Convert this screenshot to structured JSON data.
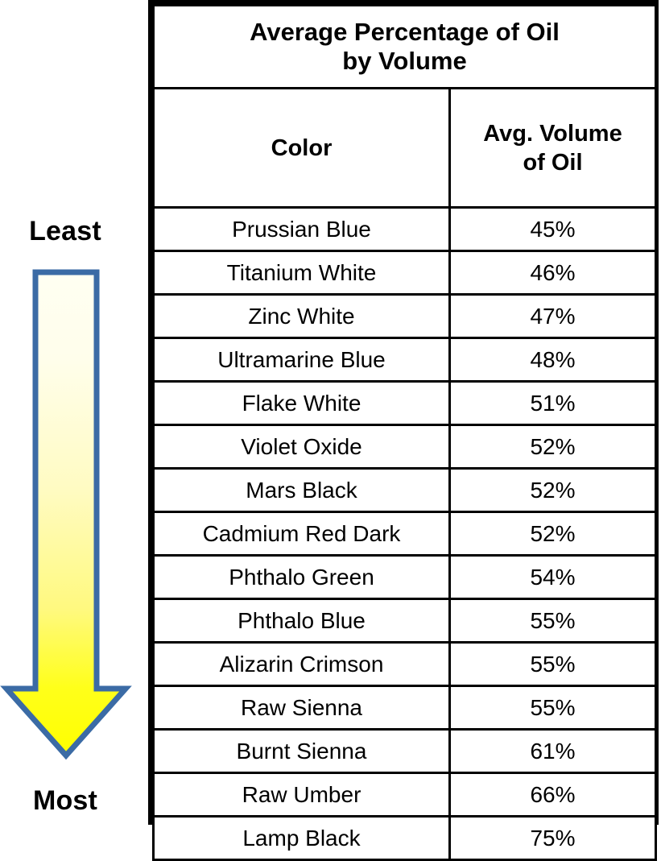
{
  "gauge": {
    "top_label": "Least",
    "bottom_label": "Most",
    "arrow_direction": "down",
    "arrow_fill_top_color": "#FFFFF2",
    "arrow_fill_bottom_color": "#FFFF00",
    "arrow_border_color": "#3B6BA5"
  },
  "table": {
    "title": "Average Percentage of Oil",
    "title_line2": "by Volume",
    "title_bg_color": "#FFC000",
    "headers": {
      "color": "Color",
      "volume_line1": "Avg. Volume",
      "volume_line2": "of Oil"
    }
  },
  "chart_data": {
    "type": "table",
    "title": "Average Percentage of Oil by Volume",
    "columns": [
      "Color",
      "Avg. Volume of Oil"
    ],
    "categories": [
      "Prussian Blue",
      "Titanium White",
      "Zinc White",
      "Ultramarine Blue",
      "Flake White",
      "Violet Oxide",
      "Mars Black",
      "Cadmium Red Dark",
      "Phthalo Green",
      "Phthalo Blue",
      "Alizarin Crimson",
      "Raw Sienna",
      "Burnt Sienna",
      "Raw Umber",
      "Lamp Black"
    ],
    "values": [
      45,
      46,
      47,
      48,
      51,
      52,
      52,
      52,
      54,
      55,
      55,
      55,
      61,
      66,
      75
    ],
    "value_labels": [
      "45%",
      "46%",
      "47%",
      "48%",
      "51%",
      "52%",
      "52%",
      "52%",
      "54%",
      "55%",
      "55%",
      "55%",
      "61%",
      "66%",
      "75%"
    ],
    "ylabel": "Avg. Volume of Oil",
    "xlabel": "Color",
    "unit": "%",
    "sort_order": "ascending",
    "annotations": [
      "Least",
      "Most"
    ],
    "rows": [
      {
        "color": "Prussian Blue",
        "volume": "45%"
      },
      {
        "color": "Titanium White",
        "volume": "46%"
      },
      {
        "color": "Zinc White",
        "volume": "47%"
      },
      {
        "color": "Ultramarine Blue",
        "volume": "48%"
      },
      {
        "color": "Flake White",
        "volume": "51%"
      },
      {
        "color": "Violet Oxide",
        "volume": "52%"
      },
      {
        "color": "Mars Black",
        "volume": "52%"
      },
      {
        "color": "Cadmium Red Dark",
        "volume": "52%"
      },
      {
        "color": "Phthalo Green",
        "volume": "54%"
      },
      {
        "color": "Phthalo Blue",
        "volume": "55%"
      },
      {
        "color": "Alizarin Crimson",
        "volume": "55%"
      },
      {
        "color": "Raw Sienna",
        "volume": "55%"
      },
      {
        "color": "Burnt Sienna",
        "volume": "61%"
      },
      {
        "color": "Raw Umber",
        "volume": "66%"
      },
      {
        "color": "Lamp Black",
        "volume": "75%"
      }
    ]
  }
}
